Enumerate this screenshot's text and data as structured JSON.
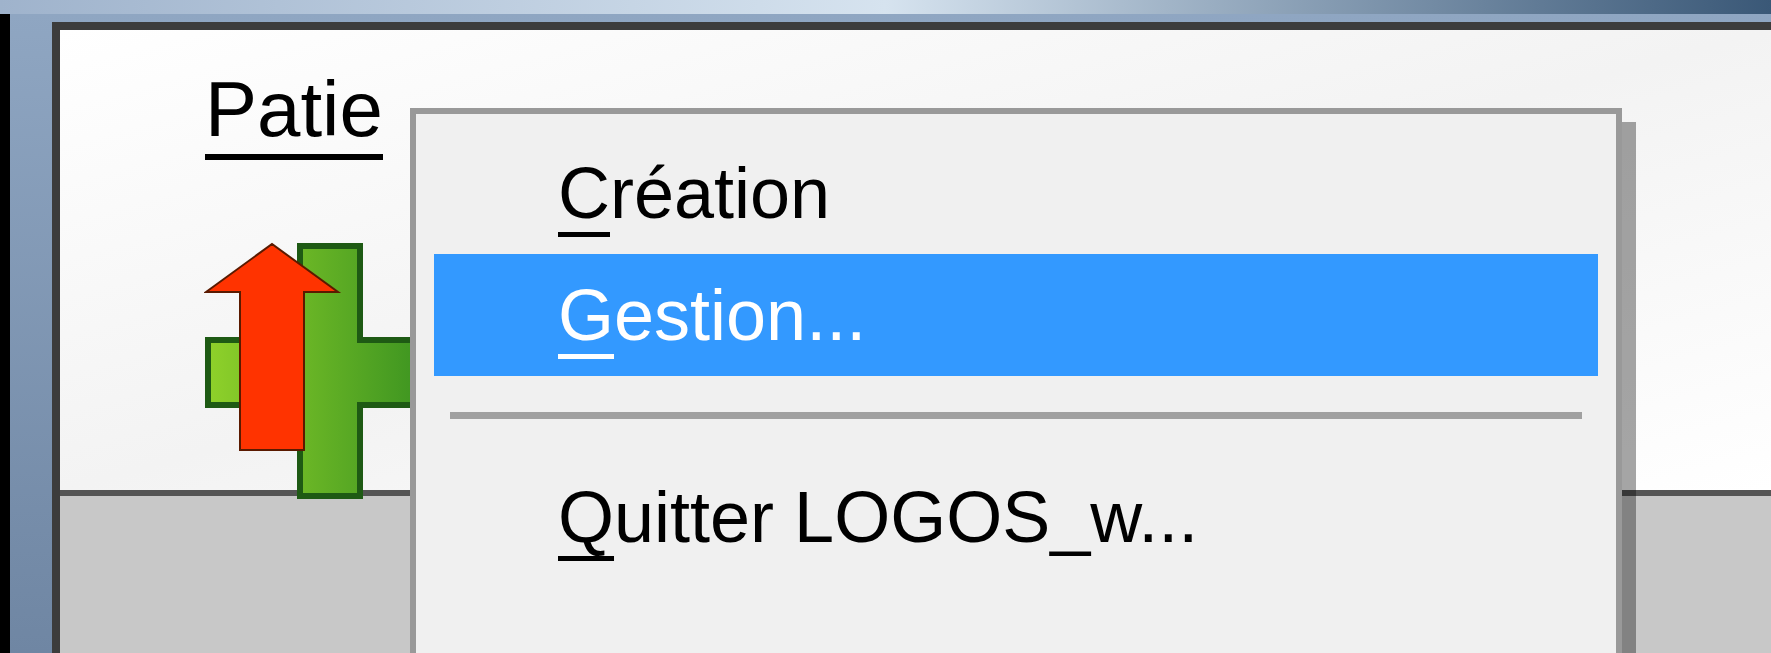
{
  "menu_bar": [
    {
      "label": "Patie",
      "selected": true
    }
  ],
  "dropdown": {
    "items": [
      {
        "kind": "item",
        "label": "Création",
        "selected": false
      },
      {
        "kind": "item",
        "label": "Gestion...",
        "selected": true
      },
      {
        "kind": "separator"
      },
      {
        "kind": "item",
        "label": "Quitter LOGOS_w...",
        "selected": false
      }
    ]
  }
}
